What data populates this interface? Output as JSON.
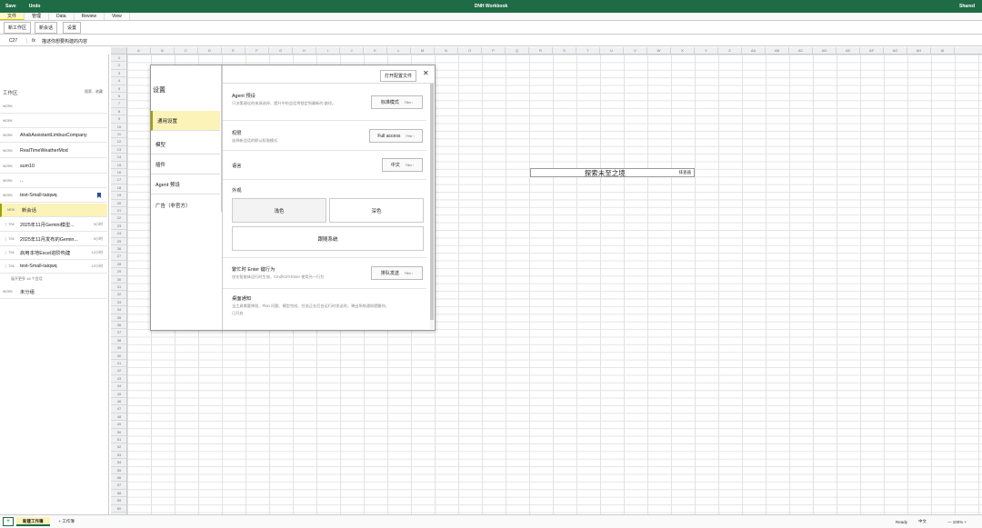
{
  "titlebar": {
    "save": "Save",
    "undo": "Undo",
    "title": "DNH Workbook",
    "user": "Shared"
  },
  "tabs": [
    "文件",
    "管理",
    "Data",
    "Review",
    "View"
  ],
  "ribbon": {
    "new_workbook": "新工作区",
    "new_chat": "新会话",
    "settings": "设置"
  },
  "formula": {
    "cellref": "C27",
    "fx": "fx",
    "value": "描述你想要构建的内容"
  },
  "columns": [
    "A",
    "B",
    "C",
    "D",
    "E",
    "F",
    "G",
    "H",
    "I",
    "J",
    "K",
    "L",
    "M",
    "N",
    "O",
    "P",
    "Q",
    "R",
    "S",
    "T",
    "U",
    "V",
    "W",
    "X",
    "Y",
    "Z",
    "AA",
    "AB",
    "AC",
    "AD",
    "AE",
    "AF",
    "AG",
    "AH",
    "AI"
  ],
  "sidebar": {
    "heading": "工作区",
    "actions": "搜索、收藏",
    "rows": [
      {
        "tag": "WORK",
        "name": "",
        "time": ""
      },
      {
        "tag": "WORK",
        "name": "",
        "time": ""
      },
      {
        "tag": "WORK",
        "name": "AhabAssistantLimbusCompany",
        "time": ""
      },
      {
        "tag": "WORK",
        "name": "RealTimeWeatherMod",
        "time": ""
      },
      {
        "tag": "WORK",
        "name": "sum10",
        "time": ""
      },
      {
        "tag": "WORK",
        "name": "..",
        "time": ""
      },
      {
        "tag": "WORK",
        "name": "test-Small-taiqwq",
        "time": ""
      }
    ],
    "children": [
      {
        "tag": "NEW",
        "name": "新会话",
        "time": ""
      },
      {
        "tag": "│ TSK",
        "name": "2025年11月Gemini模型...",
        "time": "3小时"
      },
      {
        "tag": "│ TSK",
        "name": "2025年11月发布的Gemin...",
        "time": "3小时"
      },
      {
        "tag": "│ TSK",
        "name": "启用本地Excel进阶构建",
        "time": "12小时"
      },
      {
        "tag": "│ TSK",
        "name": "test-Small-taiqwq",
        "time": "12小时"
      }
    ],
    "expand_more": "展开更多 18 个会话",
    "ungrouped": {
      "tag": "WORK",
      "name": "未分组"
    }
  },
  "float_cell": {
    "main": "探索未至之境",
    "side": "排查器"
  },
  "dialog": {
    "nav_title": "设置",
    "nav": [
      "通用设置",
      "模型",
      "插件",
      "Agent 预设",
      "广告（非官方）"
    ],
    "config_button": "打开配置文件",
    "close": "✕",
    "sections": {
      "agent": {
        "title": "Agent 预设",
        "desc": "只决策建议的来源选择，提升中的会话将锁定到最新的 路径。",
        "control": "标准模式",
        "filter": "Filter ›"
      },
      "permission": {
        "title": "权限",
        "desc": "选择新会话的默认权限模式",
        "control": "Full access",
        "filter": "Filter ›"
      },
      "language": {
        "title": "语言",
        "control": "中文",
        "filter": "Filter ›"
      },
      "appearance": {
        "title": "外观",
        "light": "浅色",
        "dark": "深色",
        "system": "跟随系统"
      },
      "enter": {
        "title": "繁忙时 Enter 键行为",
        "desc": "仅在智能体运行时生效，Cmd/Ctrl+Enter 使用另一行为",
        "control": "排队发送",
        "filter": "Filter ›"
      },
      "notify": {
        "title": "桌面通知",
        "desc": "当工具需要审批、Plan 问题、模型完成、任务正在后台运行时发送时，弹出系统通知提醒你。",
        "state": "已开启"
      }
    }
  },
  "bottom": {
    "add": "+",
    "sheet1": "新建工作簿",
    "sheet2": "+ 工作簿",
    "ready": "Ready",
    "lang": "中文",
    "zoom": "— 100% +"
  }
}
